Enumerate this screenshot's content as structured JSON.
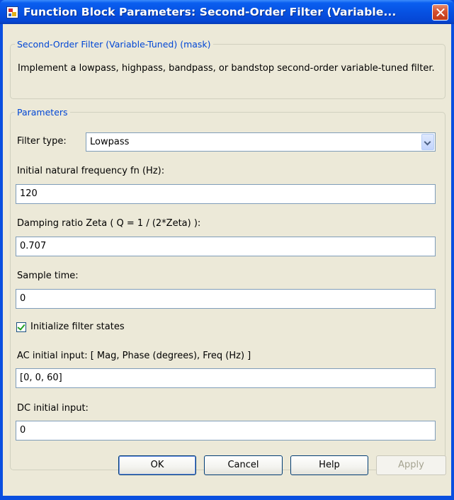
{
  "window": {
    "title": "Function Block Parameters: Second-Order Filter (Variable..."
  },
  "mask_group": {
    "legend": "Second-Order Filter (Variable-Tuned) (mask)",
    "description": "Implement a lowpass, highpass, bandpass, or bandstop second-order variable-tuned filter."
  },
  "parameters": {
    "legend": "Parameters",
    "filter_type": {
      "label": "Filter type:",
      "value": "Lowpass"
    },
    "natural_frequency": {
      "label": "Initial natural frequency fn (Hz):",
      "value": "120"
    },
    "damping_ratio": {
      "label": "Damping ratio Zeta ( Q = 1 / (2*Zeta) ):",
      "value": "0.707"
    },
    "sample_time": {
      "label": "Sample time:",
      "value": "0"
    },
    "initialize_states": {
      "label": "Initialize filter states",
      "checked": true
    },
    "ac_initial_input": {
      "label": "AC initial input: [ Mag, Phase (degrees), Freq (Hz) ]",
      "value": "[0, 0, 60]"
    },
    "dc_initial_input": {
      "label": "DC initial input:",
      "value": "0"
    }
  },
  "buttons": {
    "ok": "OK",
    "cancel": "Cancel",
    "help": "Help",
    "apply": "Apply"
  },
  "colors": {
    "title_bar": "#0651e2",
    "dialog_face": "#ece9d8",
    "group_legend": "#0046d5",
    "close_button": "#d5502f"
  }
}
